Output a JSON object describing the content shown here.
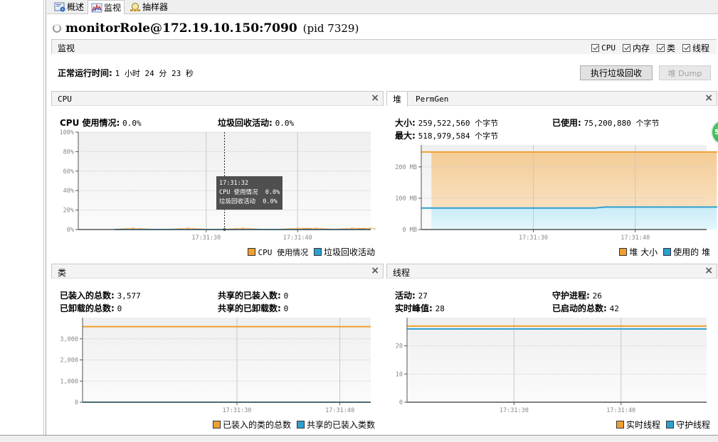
{
  "tabs": [
    {
      "label": "概述",
      "icon": "overview-icon"
    },
    {
      "label": "监视",
      "icon": "monitor-chart-icon",
      "active": true
    },
    {
      "label": "抽样器",
      "icon": "sampler-icon"
    }
  ],
  "connection": {
    "title": "monitorRole@172.19.10.150:7090",
    "pid": "(pid 7329)"
  },
  "section": {
    "label": "监视",
    "checkboxes": [
      {
        "label": "CPU",
        "checked": true
      },
      {
        "label": "内存",
        "checked": true
      },
      {
        "label": "类",
        "checked": true
      },
      {
        "label": "线程",
        "checked": true
      }
    ]
  },
  "uptime": {
    "label": "正常运行时间:",
    "value": "1 小时 24 分 23 秒"
  },
  "buttons": {
    "gc": "执行垃圾回收",
    "heap_dump": "堆 Dump"
  },
  "panels": {
    "cpu": {
      "title": "CPU",
      "stats": [
        {
          "label": "CPU 使用情况:",
          "value": "0.0%"
        },
        {
          "label": "垃圾回收活动:",
          "value": "0.0%"
        }
      ],
      "legend": [
        "CPU 使用情况",
        "垃圾回收活动"
      ],
      "tooltip": {
        "time": "17:31:32",
        "rows": [
          {
            "label": "CPU 使用情况",
            "value": "0.0%"
          },
          {
            "label": "垃圾回收活动",
            "value": "0.0%"
          }
        ]
      }
    },
    "heap": {
      "tabs": [
        "堆",
        "PermGen"
      ],
      "stats": [
        {
          "label": "大小:",
          "value": "259,522,560 个字节"
        },
        {
          "label": "已使用:",
          "value": "75,200,880 个字节"
        },
        {
          "label": "最大:",
          "value": "518,979,584 个字节"
        }
      ],
      "legend": [
        "堆 大小",
        "使用的 堆"
      ]
    },
    "classes": {
      "title": "类",
      "stats": [
        {
          "label": "已装入的总数:",
          "value": "3,577"
        },
        {
          "label": "共享的已装入数:",
          "value": "0"
        },
        {
          "label": "已卸载的总数:",
          "value": "0"
        },
        {
          "label": "共享的已卸载数:",
          "value": "0"
        }
      ],
      "legend": [
        "已装入的类的总数",
        "共享的已装入类数"
      ]
    },
    "threads": {
      "title": "线程",
      "stats": [
        {
          "label": "活动:",
          "value": "27"
        },
        {
          "label": "守护进程:",
          "value": "26"
        },
        {
          "label": "实时峰值:",
          "value": "28"
        },
        {
          "label": "已启动的总数:",
          "value": "42"
        }
      ],
      "legend": [
        "实时线程",
        "守护线程"
      ]
    }
  },
  "colors": {
    "orange": "#f0a030",
    "blue": "#2ea0d0",
    "orange_fill": "#f5d3a2",
    "blue_fill": "#d4f1fb"
  },
  "chart_data": [
    {
      "type": "line",
      "title": "CPU",
      "x": [
        "17:31:20",
        "17:31:22",
        "17:31:24",
        "17:31:26",
        "17:31:28",
        "17:31:30",
        "17:31:32",
        "17:31:34",
        "17:31:36",
        "17:31:38",
        "17:31:40",
        "17:31:42",
        "17:31:44",
        "17:31:46",
        "17:31:48"
      ],
      "x_ticks": [
        "17:31:30",
        "17:31:40"
      ],
      "y_ticks": [
        "0%",
        "20%",
        "40%",
        "60%",
        "80%",
        "100%"
      ],
      "ylim": [
        0,
        100
      ],
      "series": [
        {
          "name": "CPU 使用情况",
          "color": "#f0a030",
          "values": [
            0.0,
            0.8,
            0.0,
            0.0,
            0.8,
            0.0,
            0.0,
            0.8,
            0.0,
            0.0,
            0.8,
            0.8,
            0.0,
            0.8,
            0.8
          ]
        },
        {
          "name": "垃圾回收活动",
          "color": "#2ea0d0",
          "values": [
            0,
            0,
            0,
            0,
            0,
            0,
            0,
            0,
            0,
            0,
            0,
            0,
            0,
            0,
            0
          ]
        }
      ],
      "cursor_x": "17:31:32",
      "legend": "bottom-right",
      "grid": true
    },
    {
      "type": "area",
      "title": "堆",
      "x": [
        "17:31:20",
        "17:31:30",
        "17:31:36",
        "17:31:37",
        "17:31:40",
        "17:31:48"
      ],
      "x_ticks": [
        "17:31:30",
        "17:31:40"
      ],
      "y_ticks": [
        "0 MB",
        "100 MB",
        "200 MB"
      ],
      "ylim": [
        0,
        270
      ],
      "series": [
        {
          "name": "堆 大小",
          "color": "#f0a030",
          "values": [
            247.5,
            247.5,
            247.5,
            247.5,
            247.5,
            247.5
          ]
        },
        {
          "name": "使用的 堆",
          "color": "#2ea0d0",
          "values": [
            68.5,
            68.5,
            68.5,
            71.7,
            71.7,
            71.7
          ]
        }
      ],
      "legend": "bottom-right",
      "grid": true
    },
    {
      "type": "line",
      "title": "类",
      "x": [
        "17:31:20",
        "17:31:48"
      ],
      "x_ticks": [
        "17:31:30",
        "17:31:40"
      ],
      "y_ticks": [
        "0",
        "1,000",
        "2,000",
        "3,000"
      ],
      "ylim": [
        0,
        4000
      ],
      "series": [
        {
          "name": "已装入的类的总数",
          "color": "#f0a030",
          "values": [
            3577,
            3577
          ]
        },
        {
          "name": "共享的已装入类数",
          "color": "#2ea0d0",
          "values": [
            0,
            0
          ]
        }
      ],
      "legend": "bottom-right",
      "grid": true
    },
    {
      "type": "line",
      "title": "线程",
      "x": [
        "17:31:20",
        "17:31:48"
      ],
      "x_ticks": [
        "17:31:30",
        "17:31:40"
      ],
      "y_ticks": [
        "0",
        "10",
        "20"
      ],
      "ylim": [
        0,
        30
      ],
      "series": [
        {
          "name": "实时线程",
          "color": "#f0a030",
          "values": [
            27,
            27
          ]
        },
        {
          "name": "守护线程",
          "color": "#2ea0d0",
          "values": [
            26,
            26
          ]
        }
      ],
      "legend": "bottom-right",
      "grid": true
    }
  ]
}
